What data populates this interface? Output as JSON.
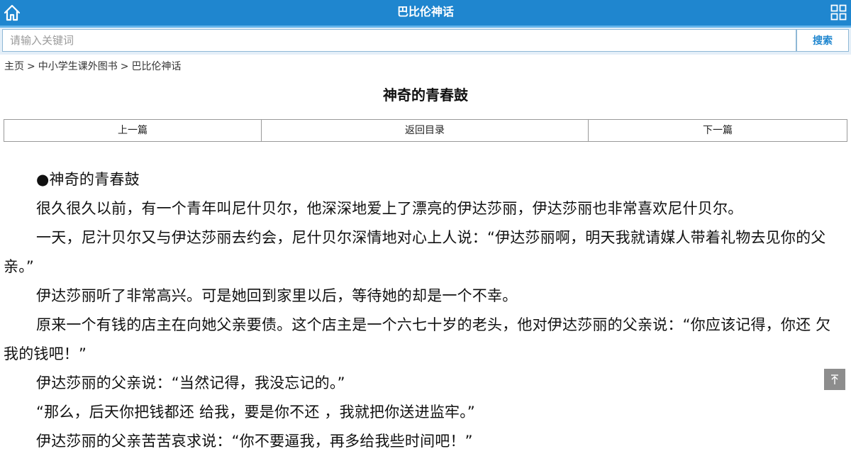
{
  "header": {
    "title": "巴比伦神话",
    "home_icon": "home-icon",
    "menu_icon": "grid-menu-icon",
    "bg_color": "#1f86cf"
  },
  "search": {
    "placeholder": "请输入关键词",
    "button_label": "搜索"
  },
  "breadcrumb": {
    "items": [
      "主页",
      "中小学生课外图书",
      "巴比伦神话"
    ],
    "separator": ">"
  },
  "article": {
    "title": "神奇的青春鼓",
    "paragraphs": [
      "●神奇的青春鼓",
      "很久很久以前，有一个青年叫尼什贝尔，他深深地爱上了漂亮的伊达莎丽，伊达莎丽也非常喜欢尼什贝尔。",
      "一天，尼汁贝尔又与伊达莎丽去约会，尼什贝尔深情地对心上人说：“伊达莎丽啊，明天我就请媒人带着礼物去见你的父亲。”",
      "伊达莎丽听了非常高兴。可是她回到家里以后，等待她的却是一个不幸。",
      "原来一个有钱的店主在向她父亲要债。这个店主是一个六七十岁的老头，他对伊达莎丽的父亲说：“你应该记得，你还 欠我的钱吧！”",
      "伊达莎丽的父亲说：“当然记得，我没忘记的。”",
      "“那么，后天你把钱都还 给我，要是你不还 ，我就把你送进监牢。”",
      "伊达莎丽的父亲苦苦哀求说：“你不要逼我，再多给我些时间吧！”"
    ]
  },
  "pager": {
    "prev": "上一篇",
    "toc": "返回目录",
    "next": "下一篇"
  },
  "back_to_top_icon": "arrow-up-to-top-icon"
}
